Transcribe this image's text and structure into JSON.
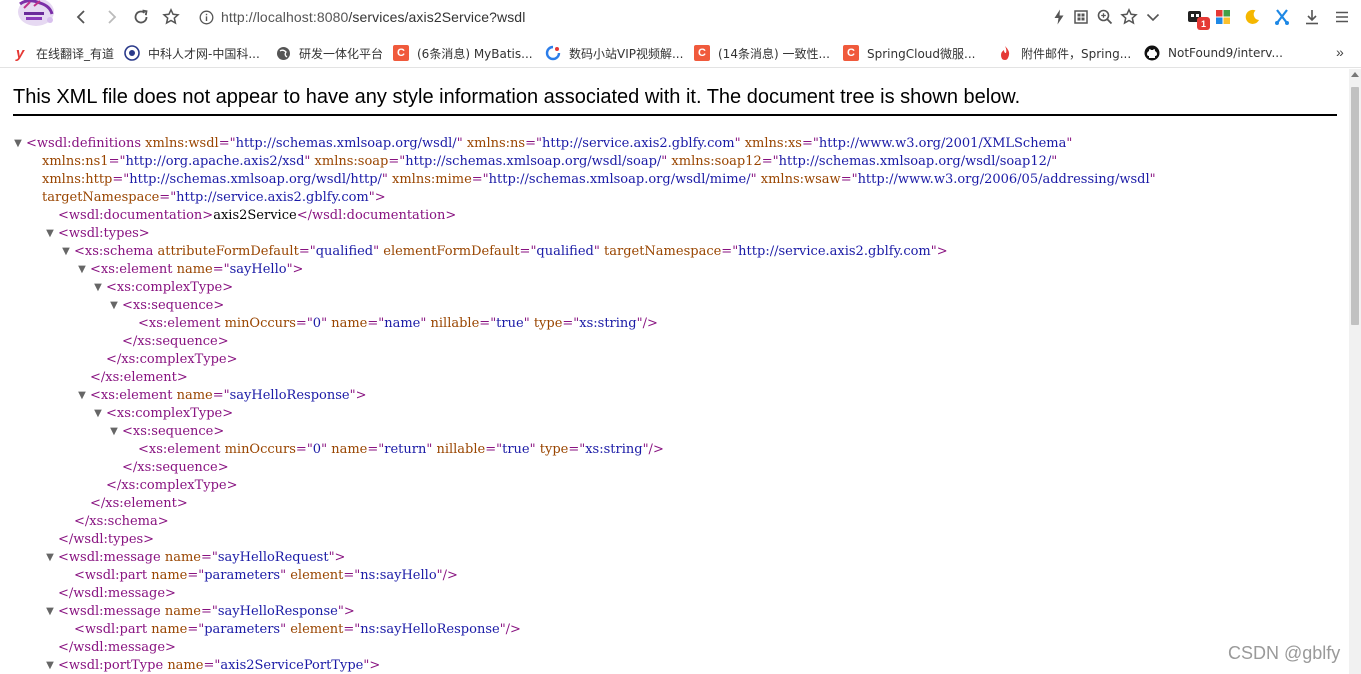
{
  "browser": {
    "url_scheme_host": "http://localhost:8080",
    "url_path": "/services/axis2Service?wsdl",
    "extension_badge": "1",
    "colors": {
      "accent_red": "#e53935",
      "tag": "#881280",
      "attr_name": "#994500",
      "attr_value": "#1a1aa6"
    }
  },
  "bookmarks": [
    {
      "label": "在线翻译_有道",
      "icon": "youdao-icon",
      "glyph": "y",
      "color": "#e53935"
    },
    {
      "label": "中科人才网-中国科...",
      "icon": "cas-talent-icon",
      "glyph": "",
      "color": "#2a3a8a"
    },
    {
      "label": "研发一体化平台",
      "icon": "globe-icon",
      "glyph": "",
      "color": "#555555"
    },
    {
      "label": "(6条消息) MyBatis...",
      "icon": "csdn-icon",
      "glyph": "C",
      "color": "#f05a3c"
    },
    {
      "label": "数码小站VIP视频解...",
      "icon": "digital-station-icon",
      "glyph": "",
      "color": "#2b7de9"
    },
    {
      "label": "(14条消息) 一致性...",
      "icon": "csdn-icon",
      "glyph": "C",
      "color": "#f05a3c"
    },
    {
      "label": "SpringCloud微服...",
      "icon": "csdn-icon",
      "glyph": "C",
      "color": "#f05a3c"
    },
    {
      "label": "附件邮件，Spring...",
      "icon": "flame-icon",
      "glyph": "",
      "color": "#e53935"
    },
    {
      "label": "NotFound9/interv...",
      "icon": "github-icon",
      "glyph": "",
      "color": "#111111"
    }
  ],
  "banner": "This XML file does not appear to have any style information associated with it. The document tree is shown below.",
  "xml_lines": [
    {
      "i": 0,
      "t": 1,
      "s": [
        [
          "tag",
          "<wsdl:definitions"
        ],
        [
          "tx",
          " "
        ],
        [
          "an",
          "xmlns:wsdl"
        ],
        [
          "tag",
          "=\""
        ],
        [
          "av",
          "http://schemas.xmlsoap.org/wsdl/"
        ],
        [
          "tag",
          "\""
        ],
        [
          "tx",
          " "
        ],
        [
          "an",
          "xmlns:ns"
        ],
        [
          "tag",
          "=\""
        ],
        [
          "av",
          "http://service.axis2.gblfy.com"
        ],
        [
          "tag",
          "\""
        ],
        [
          "tx",
          " "
        ],
        [
          "an",
          "xmlns:xs"
        ],
        [
          "tag",
          "=\""
        ],
        [
          "av",
          "http://www.w3.org/2001/XMLSchema"
        ],
        [
          "tag",
          "\""
        ]
      ]
    },
    {
      "i": 1,
      "t": 0,
      "s": [
        [
          "an",
          "xmlns:ns1"
        ],
        [
          "tag",
          "=\""
        ],
        [
          "av",
          "http://org.apache.axis2/xsd"
        ],
        [
          "tag",
          "\""
        ],
        [
          "tx",
          " "
        ],
        [
          "an",
          "xmlns:soap"
        ],
        [
          "tag",
          "=\""
        ],
        [
          "av",
          "http://schemas.xmlsoap.org/wsdl/soap/"
        ],
        [
          "tag",
          "\""
        ],
        [
          "tx",
          " "
        ],
        [
          "an",
          "xmlns:soap12"
        ],
        [
          "tag",
          "=\""
        ],
        [
          "av",
          "http://schemas.xmlsoap.org/wsdl/soap12/"
        ],
        [
          "tag",
          "\""
        ]
      ]
    },
    {
      "i": 1,
      "t": 0,
      "s": [
        [
          "an",
          "xmlns:http"
        ],
        [
          "tag",
          "=\""
        ],
        [
          "av",
          "http://schemas.xmlsoap.org/wsdl/http/"
        ],
        [
          "tag",
          "\""
        ],
        [
          "tx",
          " "
        ],
        [
          "an",
          "xmlns:mime"
        ],
        [
          "tag",
          "=\""
        ],
        [
          "av",
          "http://schemas.xmlsoap.org/wsdl/mime/"
        ],
        [
          "tag",
          "\""
        ],
        [
          "tx",
          " "
        ],
        [
          "an",
          "xmlns:wsaw"
        ],
        [
          "tag",
          "=\""
        ],
        [
          "av",
          "http://www.w3.org/2006/05/addressing/wsdl"
        ],
        [
          "tag",
          "\""
        ]
      ]
    },
    {
      "i": 1,
      "t": 0,
      "s": [
        [
          "an",
          "targetNamespace"
        ],
        [
          "tag",
          "=\""
        ],
        [
          "av",
          "http://service.axis2.gblfy.com"
        ],
        [
          "tag",
          "\">"
        ]
      ]
    },
    {
      "i": 2,
      "t": 0,
      "s": [
        [
          "tag",
          "<wsdl:documentation>"
        ],
        [
          "tx",
          "axis2Service"
        ],
        [
          "tag",
          "</wsdl:documentation>"
        ]
      ]
    },
    {
      "i": 2,
      "t": 1,
      "s": [
        [
          "tag",
          "<wsdl:types>"
        ]
      ]
    },
    {
      "i": 3,
      "t": 1,
      "s": [
        [
          "tag",
          "<xs:schema"
        ],
        [
          "tx",
          " "
        ],
        [
          "an",
          "attributeFormDefault"
        ],
        [
          "tag",
          "=\""
        ],
        [
          "av",
          "qualified"
        ],
        [
          "tag",
          "\""
        ],
        [
          "tx",
          " "
        ],
        [
          "an",
          "elementFormDefault"
        ],
        [
          "tag",
          "=\""
        ],
        [
          "av",
          "qualified"
        ],
        [
          "tag",
          "\""
        ],
        [
          "tx",
          " "
        ],
        [
          "an",
          "targetNamespace"
        ],
        [
          "tag",
          "=\""
        ],
        [
          "av",
          "http://service.axis2.gblfy.com"
        ],
        [
          "tag",
          "\">"
        ]
      ]
    },
    {
      "i": 4,
      "t": 1,
      "s": [
        [
          "tag",
          "<xs:element"
        ],
        [
          "tx",
          " "
        ],
        [
          "an",
          "name"
        ],
        [
          "tag",
          "=\""
        ],
        [
          "av",
          "sayHello"
        ],
        [
          "tag",
          "\">"
        ]
      ]
    },
    {
      "i": 5,
      "t": 1,
      "s": [
        [
          "tag",
          "<xs:complexType>"
        ]
      ]
    },
    {
      "i": 6,
      "t": 1,
      "s": [
        [
          "tag",
          "<xs:sequence>"
        ]
      ]
    },
    {
      "i": 7,
      "t": 0,
      "s": [
        [
          "tag",
          "<xs:element"
        ],
        [
          "tx",
          " "
        ],
        [
          "an",
          "minOccurs"
        ],
        [
          "tag",
          "=\""
        ],
        [
          "av",
          "0"
        ],
        [
          "tag",
          "\""
        ],
        [
          "tx",
          " "
        ],
        [
          "an",
          "name"
        ],
        [
          "tag",
          "=\""
        ],
        [
          "av",
          "name"
        ],
        [
          "tag",
          "\""
        ],
        [
          "tx",
          " "
        ],
        [
          "an",
          "nillable"
        ],
        [
          "tag",
          "=\""
        ],
        [
          "av",
          "true"
        ],
        [
          "tag",
          "\""
        ],
        [
          "tx",
          " "
        ],
        [
          "an",
          "type"
        ],
        [
          "tag",
          "=\""
        ],
        [
          "av",
          "xs:string"
        ],
        [
          "tag",
          "\"/>"
        ]
      ]
    },
    {
      "i": 6,
      "t": 0,
      "s": [
        [
          "tag",
          "</xs:sequence>"
        ]
      ]
    },
    {
      "i": 5,
      "t": 0,
      "s": [
        [
          "tag",
          "</xs:complexType>"
        ]
      ]
    },
    {
      "i": 4,
      "t": 0,
      "s": [
        [
          "tag",
          "</xs:element>"
        ]
      ]
    },
    {
      "i": 4,
      "t": 1,
      "s": [
        [
          "tag",
          "<xs:element"
        ],
        [
          "tx",
          " "
        ],
        [
          "an",
          "name"
        ],
        [
          "tag",
          "=\""
        ],
        [
          "av",
          "sayHelloResponse"
        ],
        [
          "tag",
          "\">"
        ]
      ]
    },
    {
      "i": 5,
      "t": 1,
      "s": [
        [
          "tag",
          "<xs:complexType>"
        ]
      ]
    },
    {
      "i": 6,
      "t": 1,
      "s": [
        [
          "tag",
          "<xs:sequence>"
        ]
      ]
    },
    {
      "i": 7,
      "t": 0,
      "s": [
        [
          "tag",
          "<xs:element"
        ],
        [
          "tx",
          " "
        ],
        [
          "an",
          "minOccurs"
        ],
        [
          "tag",
          "=\""
        ],
        [
          "av",
          "0"
        ],
        [
          "tag",
          "\""
        ],
        [
          "tx",
          " "
        ],
        [
          "an",
          "name"
        ],
        [
          "tag",
          "=\""
        ],
        [
          "av",
          "return"
        ],
        [
          "tag",
          "\""
        ],
        [
          "tx",
          " "
        ],
        [
          "an",
          "nillable"
        ],
        [
          "tag",
          "=\""
        ],
        [
          "av",
          "true"
        ],
        [
          "tag",
          "\""
        ],
        [
          "tx",
          " "
        ],
        [
          "an",
          "type"
        ],
        [
          "tag",
          "=\""
        ],
        [
          "av",
          "xs:string"
        ],
        [
          "tag",
          "\"/>"
        ]
      ]
    },
    {
      "i": 6,
      "t": 0,
      "s": [
        [
          "tag",
          "</xs:sequence>"
        ]
      ]
    },
    {
      "i": 5,
      "t": 0,
      "s": [
        [
          "tag",
          "</xs:complexType>"
        ]
      ]
    },
    {
      "i": 4,
      "t": 0,
      "s": [
        [
          "tag",
          "</xs:element>"
        ]
      ]
    },
    {
      "i": 3,
      "t": 0,
      "s": [
        [
          "tag",
          "</xs:schema>"
        ]
      ]
    },
    {
      "i": 2,
      "t": 0,
      "s": [
        [
          "tag",
          "</wsdl:types>"
        ]
      ]
    },
    {
      "i": 2,
      "t": 1,
      "s": [
        [
          "tag",
          "<wsdl:message"
        ],
        [
          "tx",
          " "
        ],
        [
          "an",
          "name"
        ],
        [
          "tag",
          "=\""
        ],
        [
          "av",
          "sayHelloRequest"
        ],
        [
          "tag",
          "\">"
        ]
      ]
    },
    {
      "i": 3,
      "t": 0,
      "s": [
        [
          "tag",
          "<wsdl:part"
        ],
        [
          "tx",
          " "
        ],
        [
          "an",
          "name"
        ],
        [
          "tag",
          "=\""
        ],
        [
          "av",
          "parameters"
        ],
        [
          "tag",
          "\""
        ],
        [
          "tx",
          " "
        ],
        [
          "an",
          "element"
        ],
        [
          "tag",
          "=\""
        ],
        [
          "av",
          "ns:sayHello"
        ],
        [
          "tag",
          "\"/>"
        ]
      ]
    },
    {
      "i": 2,
      "t": 0,
      "s": [
        [
          "tag",
          "</wsdl:message>"
        ]
      ]
    },
    {
      "i": 2,
      "t": 1,
      "s": [
        [
          "tag",
          "<wsdl:message"
        ],
        [
          "tx",
          " "
        ],
        [
          "an",
          "name"
        ],
        [
          "tag",
          "=\""
        ],
        [
          "av",
          "sayHelloResponse"
        ],
        [
          "tag",
          "\">"
        ]
      ]
    },
    {
      "i": 3,
      "t": 0,
      "s": [
        [
          "tag",
          "<wsdl:part"
        ],
        [
          "tx",
          " "
        ],
        [
          "an",
          "name"
        ],
        [
          "tag",
          "=\""
        ],
        [
          "av",
          "parameters"
        ],
        [
          "tag",
          "\""
        ],
        [
          "tx",
          " "
        ],
        [
          "an",
          "element"
        ],
        [
          "tag",
          "=\""
        ],
        [
          "av",
          "ns:sayHelloResponse"
        ],
        [
          "tag",
          "\"/>"
        ]
      ]
    },
    {
      "i": 2,
      "t": 0,
      "s": [
        [
          "tag",
          "</wsdl:message>"
        ]
      ]
    },
    {
      "i": 2,
      "t": 1,
      "s": [
        [
          "tag",
          "<wsdl:portType"
        ],
        [
          "tx",
          " "
        ],
        [
          "an",
          "name"
        ],
        [
          "tag",
          "=\""
        ],
        [
          "av",
          "axis2ServicePortType"
        ],
        [
          "tag",
          "\">"
        ]
      ]
    }
  ],
  "watermark": "CSDN @gblfy"
}
